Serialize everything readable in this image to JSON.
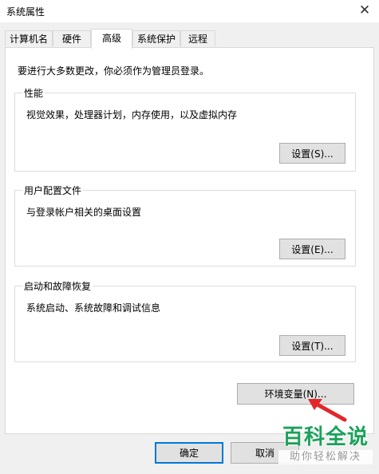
{
  "window": {
    "title": "系统属性",
    "close_glyph": "✕"
  },
  "tabs": [
    {
      "label": "计算机名"
    },
    {
      "label": "硬件"
    },
    {
      "label": "高级",
      "active": true
    },
    {
      "label": "系统保护"
    },
    {
      "label": "远程"
    }
  ],
  "notice": "要进行大多数更改，你必须作为管理员登录。",
  "performance": {
    "title": "性能",
    "description": "视觉效果，处理器计划，内存使用，以及虚拟内存",
    "button": "设置(S)..."
  },
  "user_profiles": {
    "title": "用户配置文件",
    "description": "与登录帐户相关的桌面设置",
    "button": "设置(E)..."
  },
  "startup_recovery": {
    "title": "启动和故障恢复",
    "description": "系统启动、系统故障和调试信息",
    "button": "设置(T)..."
  },
  "env_button": "环境变量(N)...",
  "footer": {
    "ok": "确定",
    "cancel": "取消"
  },
  "watermark": {
    "main": "百科全说",
    "sub": "助你轻松解决"
  },
  "colors": {
    "accent": "#0078d7",
    "arrow": "#e3262b",
    "watermark": "#1aa15a"
  }
}
